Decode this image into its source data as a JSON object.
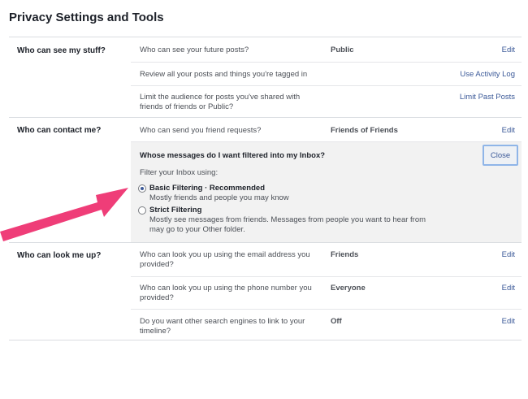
{
  "page": {
    "title": "Privacy Settings and Tools"
  },
  "sections": {
    "stuff": {
      "label": "Who can see my stuff?",
      "rows": [
        {
          "question": "Who can see your future posts?",
          "value": "Public",
          "action": "Edit"
        },
        {
          "question": "Review all your posts and things you're tagged in",
          "value": "",
          "action": "Use Activity Log"
        },
        {
          "question": "Limit the audience for posts you've shared with friends of friends or Public?",
          "value": "",
          "action": "Limit Past Posts"
        }
      ]
    },
    "contact": {
      "label": "Who can contact me?",
      "rows": [
        {
          "question": "Who can send you friend requests?",
          "value": "Friends of Friends",
          "action": "Edit"
        }
      ],
      "panel": {
        "title": "Whose messages do I want filtered into my Inbox?",
        "close_label": "Close",
        "filter_label": "Filter your Inbox using:",
        "options": [
          {
            "title": "Basic Filtering · Recommended",
            "desc": "Mostly friends and people you may know",
            "checked": true
          },
          {
            "title": "Strict Filtering",
            "desc": "Mostly see messages from friends. Messages from people you want to hear from may go to your Other folder.",
            "checked": false
          }
        ]
      }
    },
    "lookup": {
      "label": "Who can look me up?",
      "rows": [
        {
          "question": "Who can look you up using the email address you provided?",
          "value": "Friends",
          "action": "Edit"
        },
        {
          "question": "Who can look you up using the phone number you provided?",
          "value": "Everyone",
          "action": "Edit"
        },
        {
          "question": "Do you want other search engines to link to your timeline?",
          "value": "Off",
          "action": "Edit"
        }
      ]
    }
  },
  "colors": {
    "link": "#3b5998",
    "arrow": "#ef3d78",
    "panel_bg": "#f2f2f2"
  }
}
